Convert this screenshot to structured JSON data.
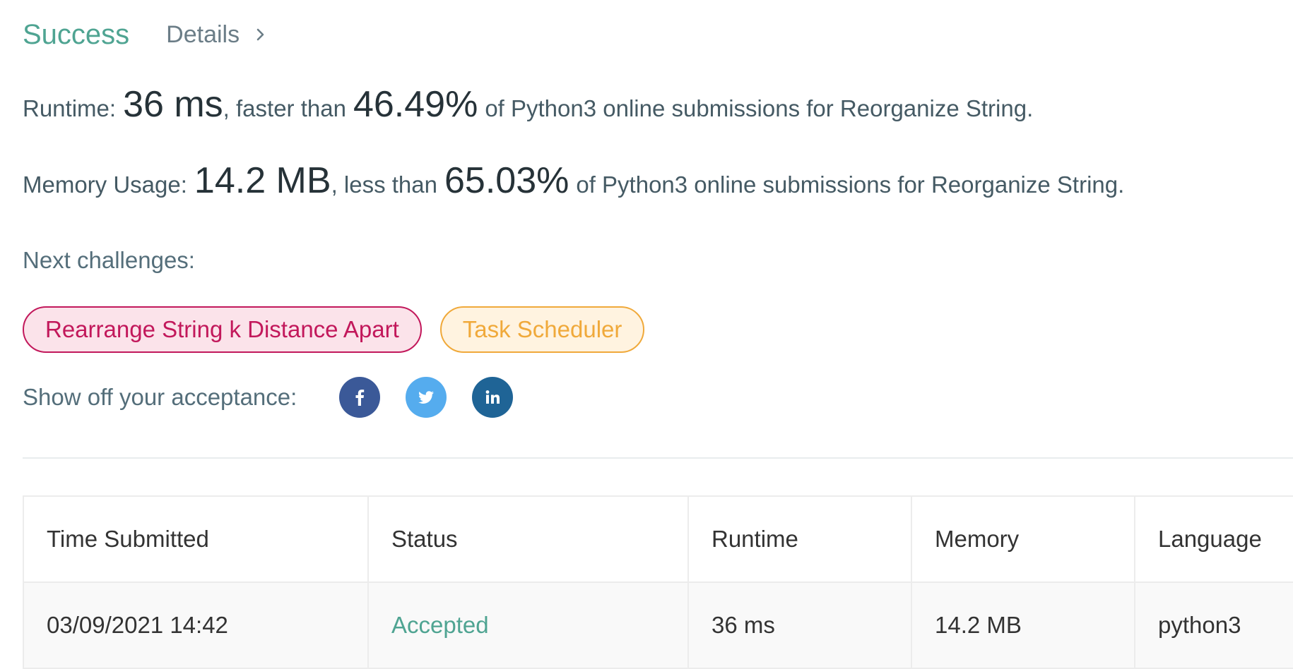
{
  "header": {
    "status": "Success",
    "details": "Details"
  },
  "runtime": {
    "label": "Runtime:",
    "value": "36 ms",
    "mid": ", faster than",
    "percent": "46.49%",
    "suffix": "of Python3 online submissions for Reorganize String."
  },
  "memory": {
    "label": "Memory Usage:",
    "value": "14.2 MB",
    "mid": ", less than",
    "percent": "65.03%",
    "suffix": "of Python3 online submissions for Reorganize String."
  },
  "next": {
    "label": "Next challenges:",
    "items": [
      {
        "label": "Rearrange String k Distance Apart"
      },
      {
        "label": "Task Scheduler"
      }
    ]
  },
  "share": {
    "label": "Show off your acceptance:",
    "icons": [
      "facebook-icon",
      "twitter-icon",
      "linkedin-icon"
    ]
  },
  "table": {
    "headers": [
      "Time Submitted",
      "Status",
      "Runtime",
      "Memory",
      "Language"
    ],
    "rows": [
      [
        "03/09/2021 14:42",
        "Accepted",
        "36 ms",
        "14.2 MB",
        "python3"
      ]
    ]
  },
  "colors": {
    "success": "#4fa492",
    "hard": "#c2185b",
    "medium": "#f0a93a",
    "facebook": "#3b5998",
    "twitter": "#55acee",
    "linkedin": "#1f6496"
  }
}
